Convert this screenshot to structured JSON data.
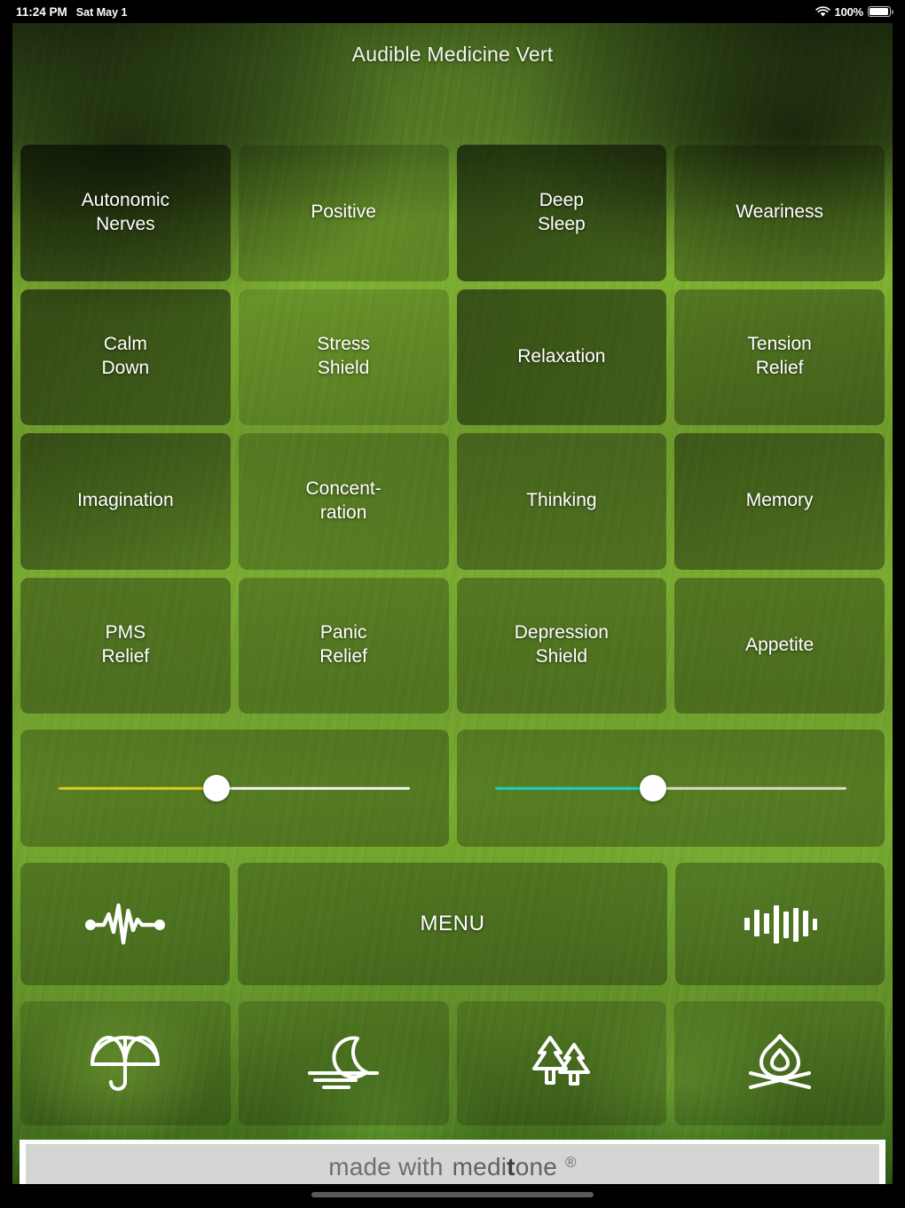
{
  "statusbar": {
    "time": "11:24 PM",
    "date": "Sat May 1",
    "wifi_icon": "wifi-icon",
    "battery_percent": "100%",
    "battery_icon": "battery-full-icon"
  },
  "header": {
    "title": "Audible Medicine Vert"
  },
  "grid": {
    "tiles": [
      {
        "label": "Autonomic\nNerves"
      },
      {
        "label": "Positive"
      },
      {
        "label": "Deep\nSleep"
      },
      {
        "label": "Weariness"
      },
      {
        "label": "Calm\nDown"
      },
      {
        "label": "Stress\nShield"
      },
      {
        "label": "Relaxation"
      },
      {
        "label": "Tension\nRelief"
      },
      {
        "label": "Imagination"
      },
      {
        "label": "Concent-\nration"
      },
      {
        "label": "Thinking"
      },
      {
        "label": "Memory"
      },
      {
        "label": "PMS\nRelief"
      },
      {
        "label": "Panic\nRelief"
      },
      {
        "label": "Depression\nShield"
      },
      {
        "label": "Appetite"
      }
    ]
  },
  "sliders": [
    {
      "name": "left-slider",
      "value_percent": 45,
      "fill_color": "#e0c91e",
      "rest_color": "#f2f4ee",
      "thumb_color": "#ffffff"
    },
    {
      "name": "right-slider",
      "value_percent": 45,
      "fill_color": "#18cfc4",
      "rest_color": "#ded9c2",
      "thumb_color": "#ffffff"
    }
  ],
  "controls": {
    "pulse_icon": "pulse-waveform-icon",
    "menu_label": "MENU",
    "equalizer_icon": "equalizer-bars-icon"
  },
  "ambience": {
    "items": [
      {
        "icon": "umbrella-rain-icon"
      },
      {
        "icon": "moon-water-night-icon"
      },
      {
        "icon": "forest-trees-icon"
      },
      {
        "icon": "campfire-icon"
      }
    ]
  },
  "footer": {
    "made_with": "made with",
    "brand_pre": "medi",
    "brand_bold": "t",
    "brand_post": "one",
    "registered_mark": "®"
  },
  "colors": {
    "accent_green": "#8cc63a",
    "tile_text": "#ffffff",
    "banner_bg": "#d4d6d4"
  }
}
